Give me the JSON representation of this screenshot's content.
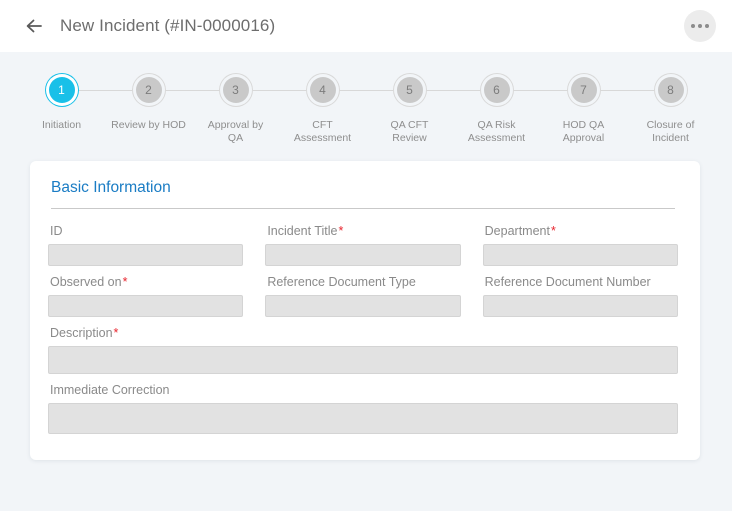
{
  "header": {
    "title": "New Incident (#IN-0000016)",
    "back_icon": "arrow-left-icon",
    "more_icon": "more-options-icon"
  },
  "stepper": {
    "active_step": 1,
    "active_color": "#19c0e8",
    "inactive_color": "#c9c9c9",
    "steps": [
      {
        "number": "1",
        "label": "Initiation"
      },
      {
        "number": "2",
        "label": "Review by HOD"
      },
      {
        "number": "3",
        "label": "Approval by\nQA"
      },
      {
        "number": "4",
        "label": "CFT\nAssessment"
      },
      {
        "number": "5",
        "label": "QA CFT\nReview"
      },
      {
        "number": "6",
        "label": "QA Risk\nAssessment"
      },
      {
        "number": "7",
        "label": "HOD QA\nApproval"
      },
      {
        "number": "8",
        "label": "Closure of\nIncident"
      }
    ]
  },
  "card": {
    "title": "Basic Information",
    "title_color": "#1a7cc4",
    "required_color": "#e8252e",
    "fields": {
      "id": {
        "label": "ID",
        "required": "",
        "value": "",
        "placeholder": ""
      },
      "incident_title": {
        "label": "Incident Title",
        "required": "*",
        "value": "",
        "placeholder": ""
      },
      "department": {
        "label": "Department",
        "required": "*",
        "value": "",
        "placeholder": ""
      },
      "observed_on": {
        "label": "Observed on",
        "required": "*",
        "value": "",
        "placeholder": ""
      },
      "ref_doc_type": {
        "label": "Reference Document Type",
        "required": "",
        "value": "",
        "placeholder": ""
      },
      "ref_doc_number": {
        "label": "Reference Document Number",
        "required": "",
        "value": "",
        "placeholder": ""
      },
      "description": {
        "label": "Description",
        "required": "*",
        "value": "",
        "placeholder": ""
      },
      "immediate_corr": {
        "label": "Immediate Correction",
        "required": "",
        "value": "",
        "placeholder": ""
      }
    }
  }
}
